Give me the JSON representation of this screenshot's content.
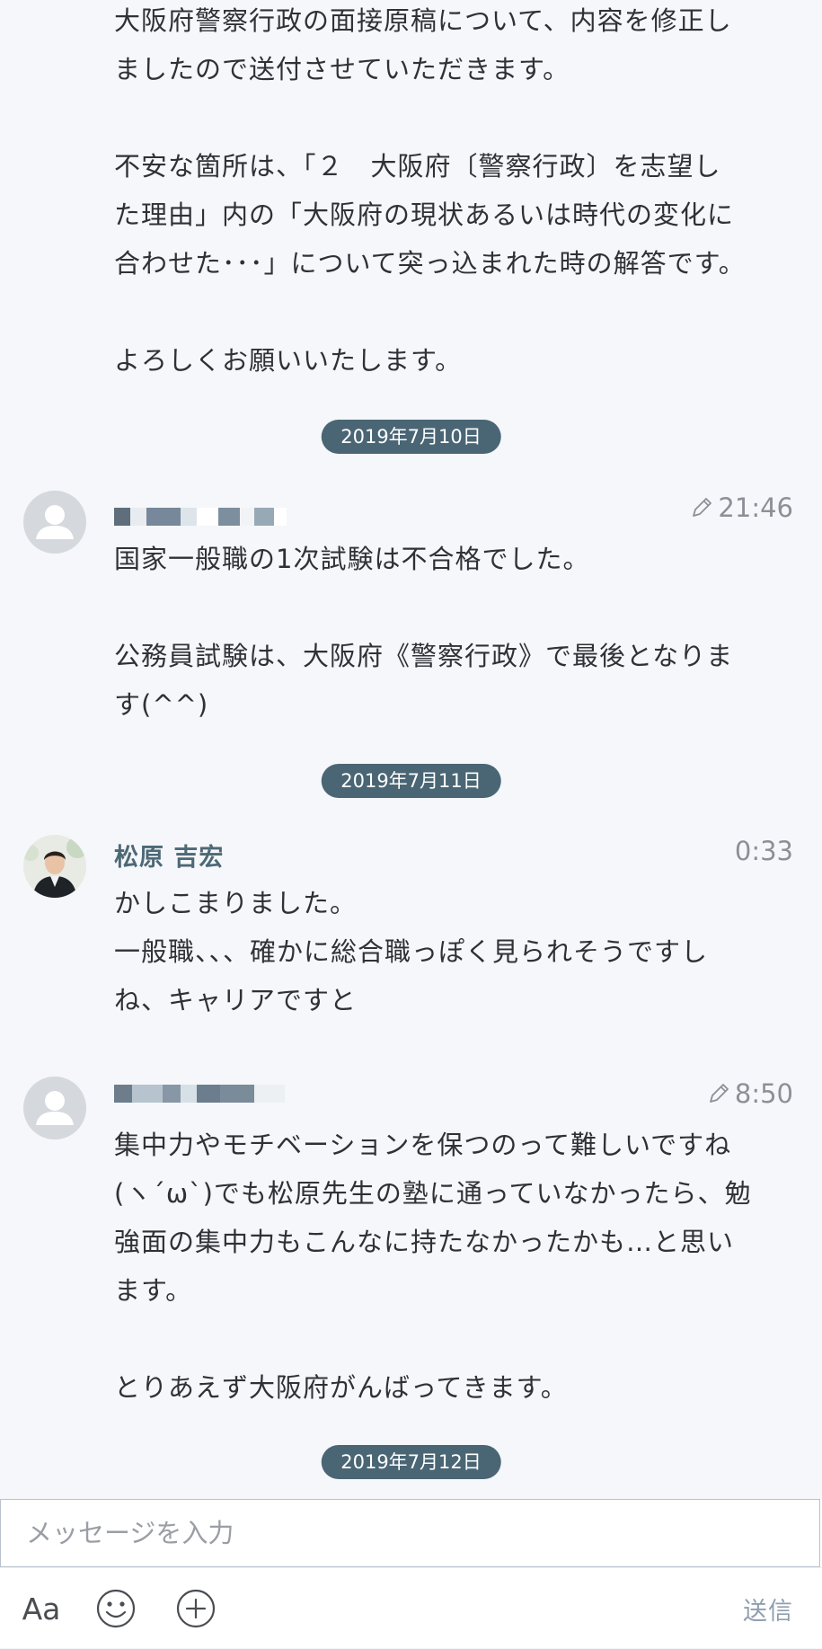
{
  "messages_top": {
    "text": "大阪府警察行政の面接原稿について、内容を修正し\nましたので送付させていただきます。\n\n不安な箇所は、「２　大阪府〔警察行政〕を志望し\nた理由」内の「大阪府の現状あるいは時代の変化に\n合わせた･･･」について突っ込まれた時の解答です。\n\nよろしくお願いいたします。"
  },
  "dates": {
    "d1": "2019年7月10日",
    "d2": "2019年7月11日",
    "d3": "2019年7月12日"
  },
  "msg1": {
    "time": "21:46",
    "text": "国家一般職の1次試験は不合格でした。\n\n公務員試験は、大阪府《警察行政》で最後となりま\nす(^^)",
    "edited_icon": "pencil-icon"
  },
  "msg2": {
    "sender": "松原 吉宏",
    "time": "0:33",
    "text": "かしこまりました。\n一般職、、、確かに総合職っぽく見られそうですし\nね、キャリアですと"
  },
  "msg3": {
    "time": "8:50",
    "text": "集中力やモチベーションを保つのって難しいですね\n(ヽ´ω`)でも松原先生の塾に通っていなかったら、勉\n強面の集中力もこんなに持たなかったかも…と思い\nます。\n\nとりあえず大阪府がんばってきます。",
    "edited_icon": "pencil-icon"
  },
  "composer": {
    "placeholder": "メッセージを入力",
    "font_label": "Aa",
    "send_label": "送信"
  },
  "colors": {
    "date_pill": "#4a6675",
    "sender_name": "#4d6876",
    "send_button": "#8f9fb0",
    "background": "#f5f7fa"
  }
}
